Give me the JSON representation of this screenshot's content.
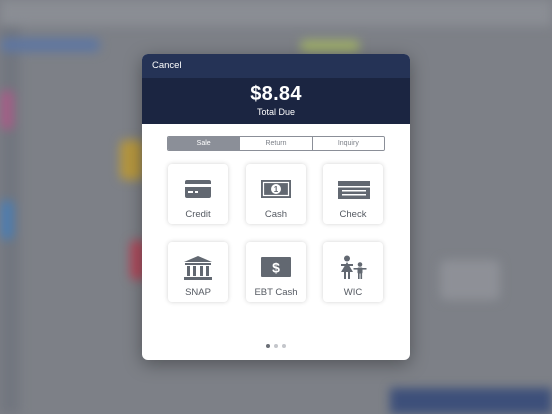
{
  "header": {
    "cancel_label": "Cancel"
  },
  "total": {
    "amount": "$8.84",
    "label": "Total Due"
  },
  "tabs": [
    {
      "label": "Sale",
      "active": true
    },
    {
      "label": "Return",
      "active": false
    },
    {
      "label": "Inquiry",
      "active": false
    }
  ],
  "tenders": [
    {
      "label": "Credit",
      "icon": "credit-card-icon"
    },
    {
      "label": "Cash",
      "icon": "cash-bill-icon"
    },
    {
      "label": "Check",
      "icon": "check-icon"
    },
    {
      "label": "SNAP",
      "icon": "bank-building-icon"
    },
    {
      "label": "EBT Cash",
      "icon": "dollar-card-icon"
    },
    {
      "label": "WIC",
      "icon": "mother-child-icon"
    }
  ],
  "pager": {
    "pages": 3,
    "current": 1
  },
  "colors": {
    "header_bg": "#253356",
    "total_bg": "#1b2541",
    "icon": "#626871",
    "segment_active": "#8b8f98"
  }
}
